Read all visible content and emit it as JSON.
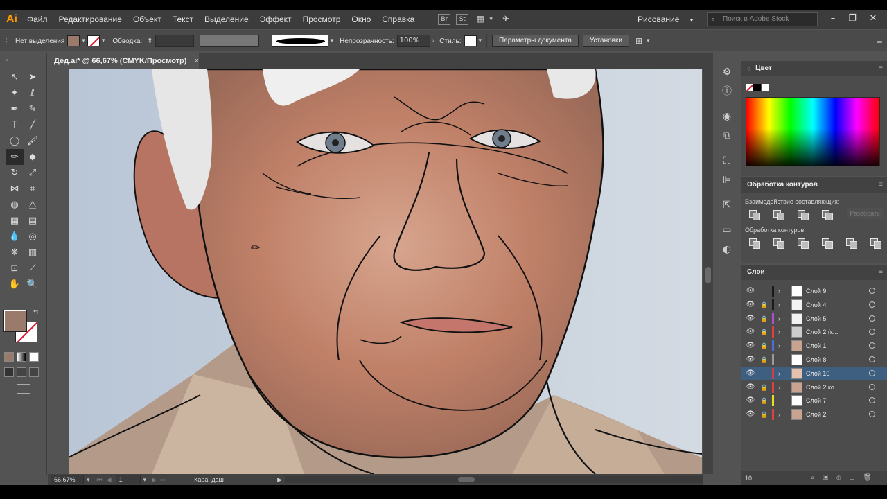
{
  "app": {
    "logo": "Ai"
  },
  "menu": [
    "Файл",
    "Редактирование",
    "Объект",
    "Текст",
    "Выделение",
    "Эффект",
    "Просмотр",
    "Окно",
    "Справка"
  ],
  "menubar_icons": {
    "bridge": "Br",
    "stock": "St"
  },
  "workspace": {
    "label": "Рисование",
    "arrow": "▾"
  },
  "stock_search": {
    "placeholder": "Поиск в Adobe Stock"
  },
  "window_controls": {
    "minimize": "–",
    "maximize": "❐",
    "close": "✕"
  },
  "controlbar": {
    "selection": "Нет выделения",
    "stroke_label": "Обводка:",
    "opacity_label": "Непрозрачность:",
    "opacity_value": "100%",
    "style_label": "Стиль:",
    "doc_params": "Параметры документа",
    "settings": "Установки"
  },
  "document": {
    "tab_title": "Дед.ai* @ 66,67% (CMYK/Просмотр)",
    "close": "×"
  },
  "status": {
    "zoom": "66,67%",
    "artboard": "1",
    "tool": "Карандаш"
  },
  "panels": {
    "color": "Цвет",
    "pathfinder": "Обработка контуров",
    "shape_modes": "Взаимодействие составляющих:",
    "pathfinders": "Обработка контуров:",
    "expand": "Разобрать",
    "layers": "Слои",
    "layer_count": "10 ..."
  },
  "layers": [
    {
      "name": "Слой 9",
      "color": "#1a1a1a",
      "lock": false,
      "arrow": true,
      "thumb": "#ffffff"
    },
    {
      "name": "Слой 4",
      "color": "#1a1a1a",
      "lock": true,
      "arrow": true,
      "thumb": "#f2f2f2"
    },
    {
      "name": "Слой 5",
      "color": "#b050d0",
      "lock": true,
      "arrow": true,
      "thumb": "#f2f2f2"
    },
    {
      "name": "Слой 2 (к...",
      "color": "#e04040",
      "lock": true,
      "arrow": true,
      "thumb": "#cccccc"
    },
    {
      "name": "Слой 1",
      "color": "#4a6ee0",
      "lock": true,
      "arrow": true,
      "thumb": "#c9a290"
    },
    {
      "name": "Слой 8",
      "color": "#9a9a9a",
      "lock": true,
      "arrow": false,
      "thumb": "#ffffff"
    },
    {
      "name": "Слой 10",
      "color": "#d04040",
      "lock": false,
      "arrow": true,
      "thumb": "#e3c3b0",
      "selected": true
    },
    {
      "name": "Слой 2 ко...",
      "color": "#e04040",
      "lock": true,
      "arrow": true,
      "thumb": "#c9a290"
    },
    {
      "name": "Слой 7",
      "color": "#e6e020",
      "lock": true,
      "arrow": false,
      "thumb": "#ffffff"
    },
    {
      "name": "Слой 2",
      "color": "#e04040",
      "lock": true,
      "arrow": true,
      "thumb": "#c9a290"
    }
  ],
  "colors": {
    "fill": "#9a7a6a",
    "stroke_none": "#e0102a",
    "selection": "#3f5f80",
    "accent": "#ff9a00"
  }
}
